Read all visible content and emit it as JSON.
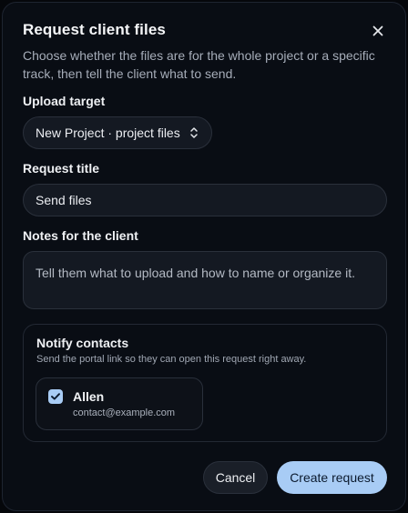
{
  "dialog": {
    "title": "Request client files",
    "description": "Choose whether the files are for the whole project or a specific track, then tell the client what to send."
  },
  "upload_target": {
    "label": "Upload target",
    "selected": "New Project · project files"
  },
  "request_title": {
    "label": "Request title",
    "value": "Send files"
  },
  "notes": {
    "label": "Notes for the client",
    "placeholder": "Tell them what to upload and how to name or organize it."
  },
  "notify": {
    "title": "Notify contacts",
    "description": "Send the portal link so they can open this request right away.",
    "contacts": [
      {
        "name": "Allen",
        "email": "contact@example.com",
        "checked": true
      }
    ]
  },
  "actions": {
    "cancel_label": "Cancel",
    "create_label": "Create request"
  },
  "colors": {
    "accent": "#a8ccf5",
    "background": "#090d14",
    "field_bg": "#141922"
  }
}
